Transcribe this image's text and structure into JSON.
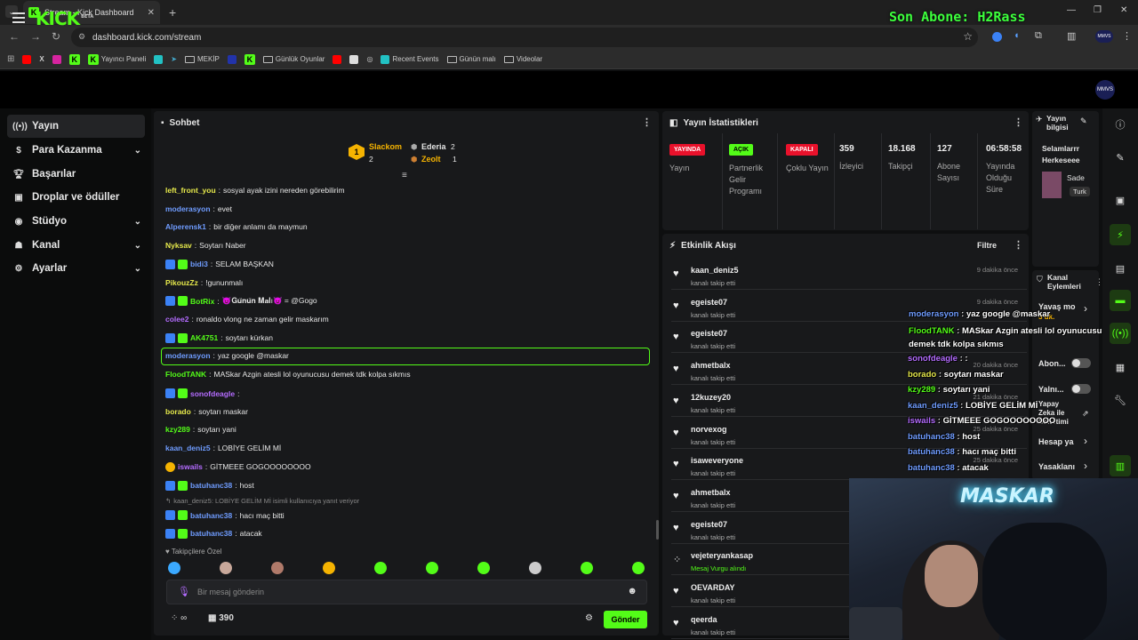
{
  "browser": {
    "tab_title": "Stream - Kick Dashboard",
    "url": "dashboard.kick.com/stream",
    "overlay_title": "Son Abone: H2Rass",
    "bookmarks": [
      "Yayıncı Paneli",
      "MEKİP",
      "Günlük Oyunlar",
      "Recent Events",
      "Günün malı",
      "Videolar"
    ]
  },
  "nav": {
    "logo": "KICK",
    "logo_sup": "BETA",
    "avatar": "MMVS"
  },
  "sidebar": {
    "items": [
      {
        "label": "Yayın"
      },
      {
        "label": "Para Kazanma"
      },
      {
        "label": "Başarılar"
      },
      {
        "label": "Droplar ve ödüller"
      },
      {
        "label": "Stüdyo"
      },
      {
        "label": "Kanal"
      },
      {
        "label": "Ayarlar"
      }
    ]
  },
  "chat": {
    "title": "Sohbet",
    "podium": {
      "first": "Slackom",
      "first_count": "2",
      "second": "Ederia",
      "second_count": "2",
      "third": "Zeolt",
      "third_count": "1"
    },
    "messages": [
      {
        "user": "left_front_you",
        "color": "#e6e94b",
        "text": "sosyal ayak izini nereden görebilirim"
      },
      {
        "user": "moderasyon",
        "color": "#6f9cff",
        "text": "evet"
      },
      {
        "user": "Alperensk1",
        "color": "#6f9cff",
        "text": "bir diğer anlamı da maymun"
      },
      {
        "user": "Nyksav",
        "color": "#e6e94b",
        "text": "Soytarı Naber"
      },
      {
        "user": "bidi3",
        "color": "#6f9cff",
        "text": "SELAM BAŞKAN"
      },
      {
        "user": "PikouzZz",
        "color": "#e6e94b",
        "text": "!gununmalı"
      },
      {
        "user": "BotRix",
        "color": "#53fc18",
        "text": "😈𝐆𝐮̈𝐧𝐮̈𝐧 𝐌𝐚𝐥ı😈 = @Gogo"
      },
      {
        "user": "colee2",
        "color": "#b46cff",
        "text": "ronaldo vlong ne zaman gelir maskarım"
      },
      {
        "user": "AK4751",
        "color": "#53fc18",
        "text": "soytarı kürkan"
      },
      {
        "user": "moderasyon",
        "color": "#6f9cff",
        "text": "yaz google @maskar"
      },
      {
        "user": "FloodTANK",
        "color": "#53fc18",
        "text": "MASkar Azgin atesli lol oyunucusu demek tdk kolpa sıkmıs"
      },
      {
        "user": "sonofdeagle",
        "color": "#b46cff",
        "text": ""
      },
      {
        "user": "borado",
        "color": "#e6e94b",
        "text": "soytarı maskar"
      },
      {
        "user": "kzy289",
        "color": "#53fc18",
        "text": "soytarı yani"
      },
      {
        "user": "kaan_deniz5",
        "color": "#6f9cff",
        "text": "LOBİYE GELİM Mİ"
      },
      {
        "user": "iswails",
        "color": "#b46cff",
        "text": "GİTMEEE GOGOOOOOOOO"
      },
      {
        "user": "batuhanc38",
        "color": "#6f9cff",
        "text": "host"
      },
      {
        "reply": "kaan_deniz5: LOBİYE GELİM Mİ isimli kullanıcıya yanıt veriyor",
        "user": "batuhanc38",
        "color": "#6f9cff",
        "text": "hacı maç bitti"
      },
      {
        "user": "batuhanc38",
        "color": "#6f9cff",
        "text": "atacak"
      }
    ],
    "followers_label": "Takipçilere Özel",
    "input_placeholder": "Bir mesaj gönderin",
    "points": "390",
    "send_label": "Gönder",
    "infinity": "∞"
  },
  "stats": {
    "title": "Yayın İstatistikleri",
    "items": [
      {
        "pill": "YAYINDA",
        "label": "Yayın"
      },
      {
        "pill": "AÇIK",
        "label": "Partnerlik Gelir Programı"
      },
      {
        "pill": "KAPALI",
        "label": "Çoklu Yayın"
      },
      {
        "value": "359",
        "label": "İzleyici"
      },
      {
        "value": "18.168",
        "label": "Takipçi"
      },
      {
        "value": "127",
        "label": "Abone Sayısı"
      },
      {
        "value": "06:58:58",
        "label": "Yayında Olduğu Süre"
      }
    ]
  },
  "activity": {
    "title": "Etkinlik Akışı",
    "filter": "Filtre",
    "events": [
      {
        "name": "kaan_deniz5",
        "sub": "kanalı takip etti",
        "time": "9 dakika önce"
      },
      {
        "name": "egeiste07",
        "sub": "kanalı takip etti",
        "time": "9 dakika önce"
      },
      {
        "name": "egeiste07",
        "sub": "kanalı takip etti",
        "time": ""
      },
      {
        "name": "ahmetbalx",
        "sub": "kanalı takip etti",
        "time": "20 dakika önce"
      },
      {
        "name": "12kuzey20",
        "sub": "kanalı takip etti",
        "time": "21 dakika önce"
      },
      {
        "name": "norvexog",
        "sub": "kanalı takip etti",
        "time": "25 dakika önce"
      },
      {
        "name": "isaweveryone",
        "sub": "kanalı takip etti",
        "time": "25 dakika önce"
      },
      {
        "name": "ahmetbalx",
        "sub": "kanalı takip etti",
        "time": ""
      },
      {
        "name": "egeiste07",
        "sub": "kanalı takip etti",
        "time": ""
      },
      {
        "name": "vejeteryankasap",
        "sub": "Mesaj Vurgu alındı",
        "time": ""
      },
      {
        "name": "OEVARDAY",
        "sub": "kanalı takip etti",
        "time": ""
      },
      {
        "name": "qeerda",
        "sub": "kanalı takip etti",
        "time": ""
      }
    ]
  },
  "info": {
    "title": "Yayın bilgisi",
    "stream_title": "Selamlarrr Herkeseee",
    "category": "Sade",
    "lang": "Turk"
  },
  "actions": {
    "title": "Kanal Eylemleri",
    "slow": "Yavaş mo",
    "slow_sub": "5 dk.",
    "subs": "Abon...",
    "follow": "Yalnı...",
    "ai": "Yapay Zeka ile Denetimi",
    "account": "Hesap ya",
    "banned": "Yasaklanı"
  },
  "overlay_chat": [
    {
      "user": "moderasyon",
      "color": "#6f9cff",
      "text": "yaz google @maskar"
    },
    {
      "user": "FloodTANK",
      "color": "#53fc18",
      "text": "MASkar Azgin atesli lol oyunucusu demek tdk kolpa sıkmıs"
    },
    {
      "user": "sonofdeagle",
      "color": "#b46cff",
      "text": ":"
    },
    {
      "user": "borado",
      "color": "#e6e94b",
      "text": "soytarı maskar"
    },
    {
      "user": "kzy289",
      "color": "#53fc18",
      "text": "soytarı yani"
    },
    {
      "user": "kaan_deniz5",
      "color": "#6f9cff",
      "text": "LOBİYE GELİM Mİ"
    },
    {
      "user": "iswails",
      "color": "#b46cff",
      "text": "GİTMEEE GOGOOOOOOOO"
    },
    {
      "user": "batuhanc38",
      "color": "#6f9cff",
      "text": "host"
    },
    {
      "user": "batuhanc38",
      "color": "#6f9cff",
      "text": "hacı maç bitti"
    },
    {
      "user": "batuhanc38",
      "color": "#6f9cff",
      "text": "atacak"
    }
  ],
  "camera": {
    "sign": "MASKAR"
  }
}
